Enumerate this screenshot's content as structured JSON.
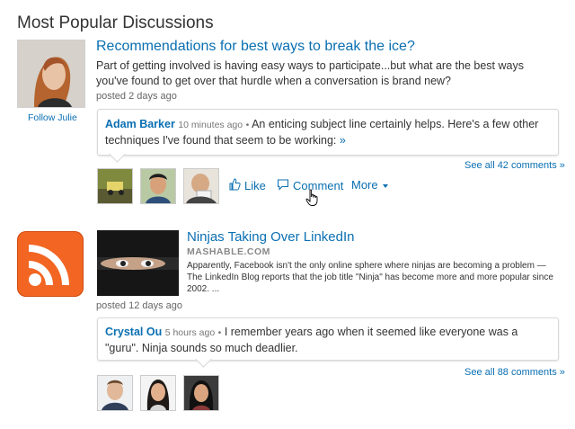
{
  "section": {
    "title": "Most Popular Discussions"
  },
  "discussion1": {
    "title": "Recommendations for best ways to break the ice?",
    "body": "Part of getting involved is having easy ways to participate...but what are the best ways you've found to get over that hurdle when a conversation is brand new?",
    "posted": "posted 2 days ago",
    "follow_label": "Follow Julie",
    "comment": {
      "author": "Adam Barker",
      "time": "10 minutes ago",
      "separator": "•",
      "text": "An enticing subject line certainly helps. Here's a few other techniques I've found that seem to be working:",
      "more": "»"
    },
    "see_all": "See all 42 comments »",
    "actions": {
      "like": "Like",
      "comment": "Comment",
      "more": "More"
    }
  },
  "discussion2": {
    "title": "Ninjas Taking Over LinkedIn",
    "source": "MASHABLE.COM",
    "summary": "Apparently, Facebook isn't the only online sphere where ninjas are becoming a problem — The LinkedIn Blog reports that the job title \"Ninja\" has become more and more popular since 2002. ...",
    "posted": "posted 12 days ago",
    "comment": {
      "author": "Crystal Ou",
      "time": "5 hours ago",
      "separator": "•",
      "text": "I remember years ago when it seemed like everyone was a \"guru\". Ninja sounds so much deadlier."
    },
    "see_all": "See all 88 comments »"
  },
  "icons": {
    "like": "thumbs-up-icon",
    "comment": "speech-bubble-icon",
    "more": "caret-down-icon",
    "rss": "rss-icon",
    "cursor": "hand-pointer-icon"
  },
  "colors": {
    "link": "#0a6fb2",
    "rss_orange": "#f26522",
    "text": "#333333"
  }
}
